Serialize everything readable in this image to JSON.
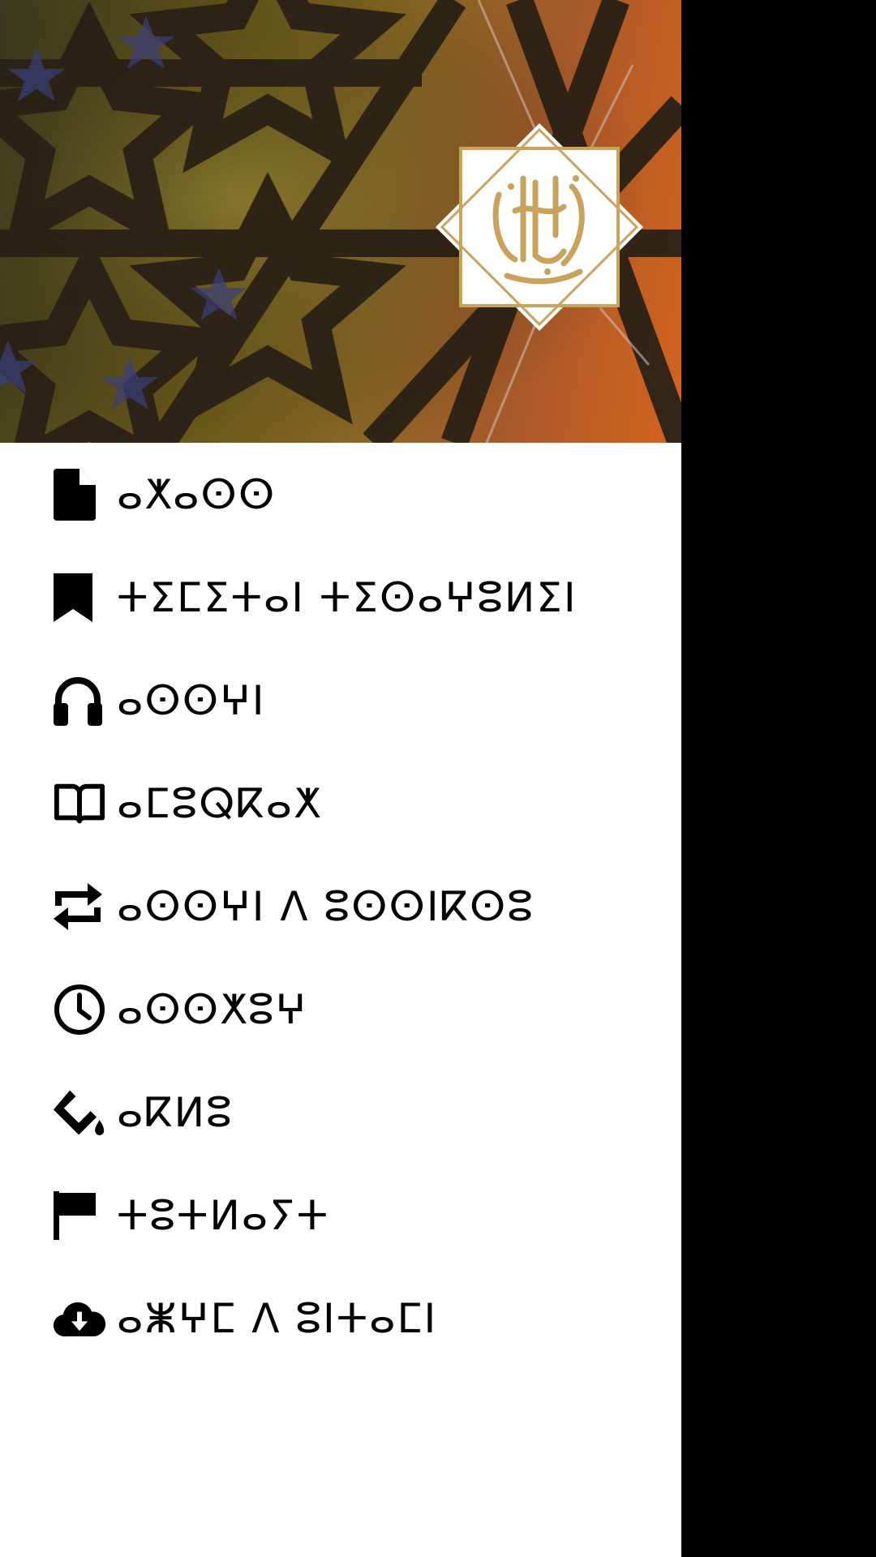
{
  "header": {
    "logo_icon": "quran-calligraphy-logo",
    "colors": {
      "pattern_dark": "#2a2116",
      "logo_gold": "#c9a25c",
      "logo_bg": "#ffffff"
    }
  },
  "menu": {
    "items": [
      {
        "icon": "file-icon",
        "label": "ⴰⵅⴰⵙⵙ"
      },
      {
        "icon": "bookmark-icon",
        "label": "ⵜⵉⵎⵉⵜⴰⵏ ⵜⵉⵙⴰⵖⵓⵍⵉⵏ"
      },
      {
        "icon": "headphones-icon",
        "label": "ⴰⵙⵙⵖⵏ"
      },
      {
        "icon": "book-open-icon",
        "label": "ⴰⵎⵓⵕⴽⴰⵅ"
      },
      {
        "icon": "repeat-icon",
        "label": "ⴰⵙⵙⵖⵏ ⴷ ⵓⵙⵙⵏⴽⵙⵓ"
      },
      {
        "icon": "clock-icon",
        "label": "ⴰⵙⵙⵅⵓⵖ"
      },
      {
        "icon": "paint-bucket-icon",
        "label": "ⴰⴽⵍⵓ"
      },
      {
        "icon": "flag-icon",
        "label": "ⵜⵓⵜⵍⴰⵢⵜ"
      },
      {
        "icon": "cloud-download-icon",
        "label": "ⴰⵥⵖⵎ ⴷ ⵓⵏⵜⴰⵎⵏ"
      }
    ]
  }
}
